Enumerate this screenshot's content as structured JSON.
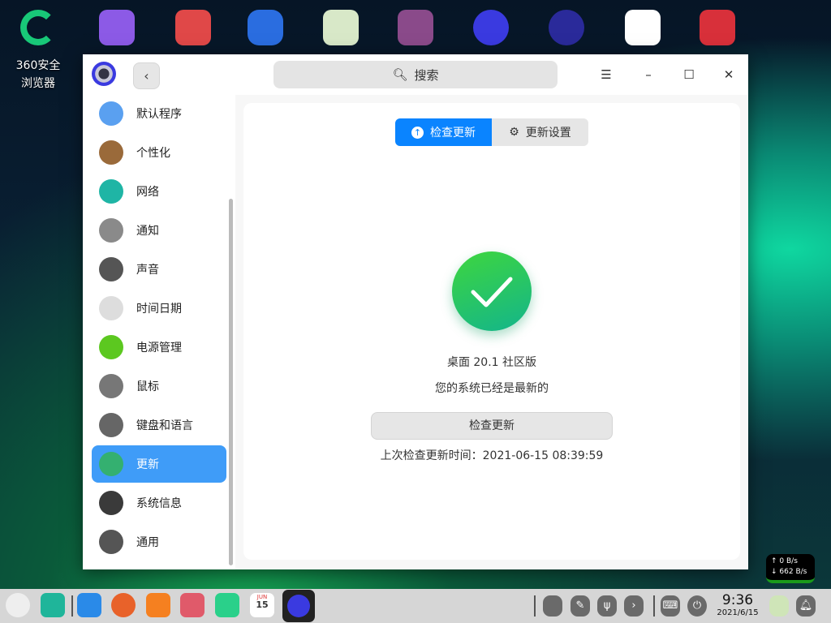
{
  "desktop": {
    "browser_label": "360安全浏览器"
  },
  "window": {
    "search_placeholder": "搜索",
    "back": "‹",
    "menu": "☰",
    "minimize": "–",
    "maximize": "☐",
    "close": "✕"
  },
  "sidebar": {
    "items": [
      {
        "label": "默认程序",
        "color": "#5aa0f0"
      },
      {
        "label": "个性化",
        "color": "#9a6a3a"
      },
      {
        "label": "网络",
        "color": "#1fb5a5"
      },
      {
        "label": "通知",
        "color": "#8a8a8a"
      },
      {
        "label": "声音",
        "color": "#555"
      },
      {
        "label": "时间日期",
        "color": "#ddd"
      },
      {
        "label": "电源管理",
        "color": "#5cc820"
      },
      {
        "label": "鼠标",
        "color": "#777"
      },
      {
        "label": "键盘和语言",
        "color": "#666"
      },
      {
        "label": "更新",
        "color": "#34b070"
      },
      {
        "label": "系统信息",
        "color": "#3a3a3a"
      },
      {
        "label": "通用",
        "color": "#555"
      }
    ],
    "selected": "更新"
  },
  "main": {
    "tabs": [
      {
        "label": "检查更新",
        "icon": "arrow-up-circle-icon"
      },
      {
        "label": "更新设置",
        "icon": "gear-icon"
      }
    ],
    "version": "桌面 20.1 社区版",
    "status": "您的系统已经是最新的",
    "check_button": "检查更新",
    "last_check": "上次检查更新时间：2021-06-15 08:39:59"
  },
  "network": {
    "up": "↑ 0 B/s",
    "down": "↓ 662 B/s"
  },
  "taskbar": {
    "time": "9:36",
    "date": "2021/6/15",
    "calendar_month": "JUN",
    "calendar_day": "15"
  }
}
